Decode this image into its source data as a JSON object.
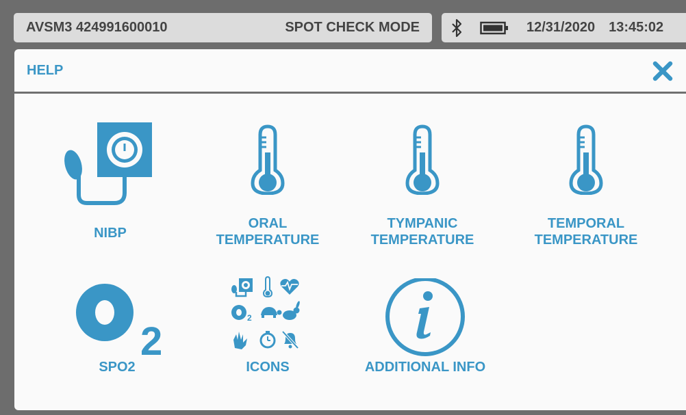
{
  "status_bar": {
    "device_id": "AVSM3 424991600010",
    "mode": "SPOT CHECK MODE",
    "date": "12/31/2020",
    "time": "13:45:02"
  },
  "dialog": {
    "title": "HELP"
  },
  "tiles": [
    {
      "label_line1": "",
      "label_line2": "NIBP",
      "icon": "blood-pressure-cuff-icon"
    },
    {
      "label_line1": "ORAL",
      "label_line2": "TEMPERATURE",
      "icon": "thermometer-icon"
    },
    {
      "label_line1": "TYMPANIC",
      "label_line2": "TEMPERATURE",
      "icon": "thermometer-icon"
    },
    {
      "label_line1": "TEMPORAL",
      "label_line2": "TEMPERATURE",
      "icon": "thermometer-icon"
    },
    {
      "label_line1": "",
      "label_line2": "SPO2",
      "icon": "o2-icon"
    },
    {
      "label_line1": "",
      "label_line2": "ICONS",
      "icon": "icon-grid-icon"
    },
    {
      "label_line1": "",
      "label_line2": "ADDITIONAL INFO",
      "icon": "info-icon"
    }
  ],
  "o2_subscript": "2",
  "colors": {
    "accent": "#3a96c6",
    "panel": "#fafafa",
    "status_bar": "#dcdcdc",
    "frame": "#6d6d6d"
  }
}
